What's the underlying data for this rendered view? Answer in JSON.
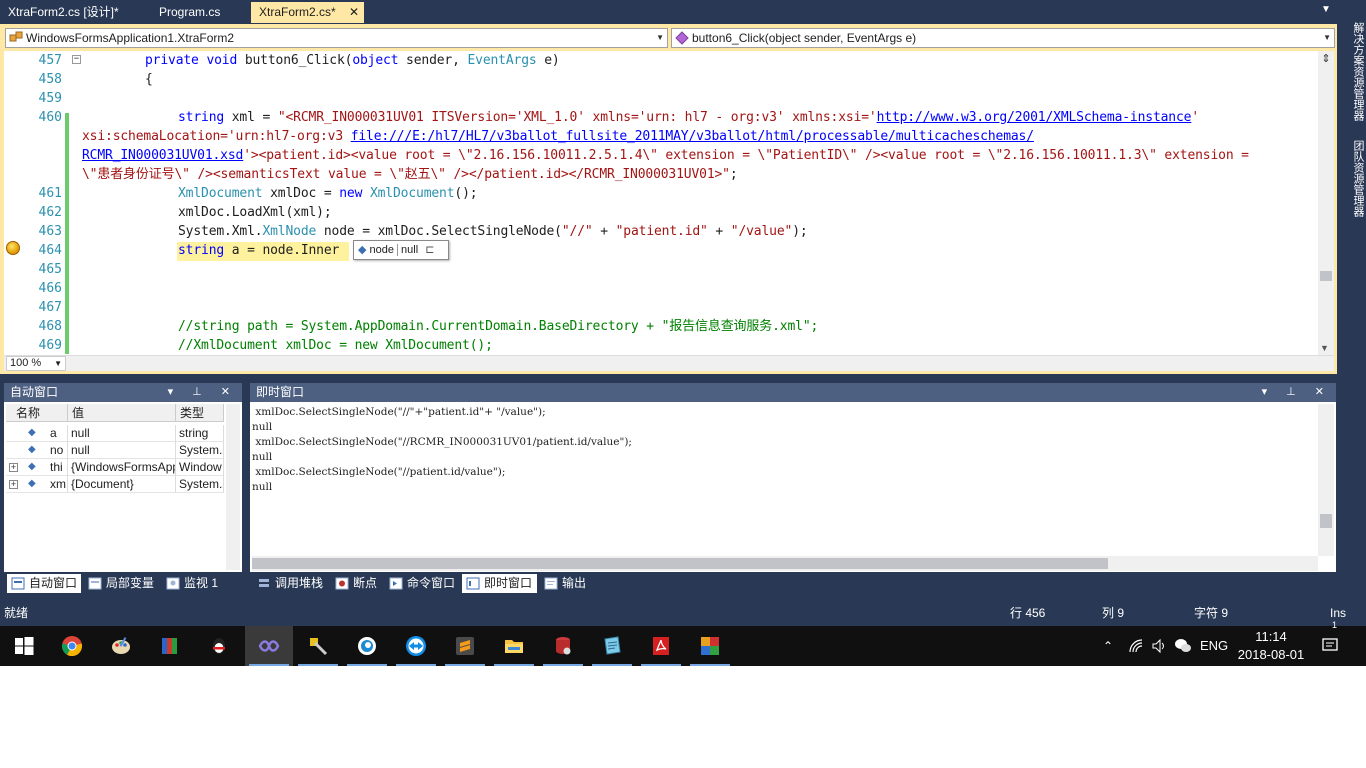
{
  "tabs": [
    {
      "label": "XtraForm2.cs [设计]*",
      "active": false
    },
    {
      "label": "Program.cs",
      "active": false
    },
    {
      "label": "XtraForm2.cs*",
      "active": true,
      "close": "✕"
    }
  ],
  "nav": {
    "class_combo": "WindowsFormsApplication1.XtraForm2",
    "member_combo": "button6_Click(object sender, EventArgs e)"
  },
  "code": {
    "lines": [
      {
        "num": "457"
      },
      {
        "num": "458"
      },
      {
        "num": "459"
      },
      {
        "num": "460"
      },
      {
        "num": ""
      },
      {
        "num": ""
      },
      {
        "num": ""
      },
      {
        "num": "461"
      },
      {
        "num": "462"
      },
      {
        "num": "463"
      },
      {
        "num": "464"
      },
      {
        "num": "465"
      },
      {
        "num": "466"
      },
      {
        "num": "467"
      },
      {
        "num": "468"
      },
      {
        "num": "469"
      }
    ],
    "t": {
      "l457a": "private",
      "l457b": "void",
      "l457c": " button6_Click(",
      "l457d": "object",
      "l457e": " sender, ",
      "l457f": "EventArgs",
      "l457g": " e)",
      "l458": "{",
      "l460a": "string",
      "l460b": " xml = ",
      "l460c": "\"<RCMR_IN000031UV01 ITSVersion='XML_1.0' xmlns='urn: hl7 - org:v3' xmlns:xsi='",
      "l460d": "http://www.w3.org/2001/XMLSchema-instance",
      "l460e": "'",
      "l460f": "xsi:schemaLocation='urn:hl7-org:v3 ",
      "l460g": "file:///E:/hl7/HL7/v3ballot_fullsite_2011MAY/v3ballot/html/processable/multicacheschemas/",
      "l460h": "RCMR_IN000031UV01.xsd",
      "l460i": "'><patient.id><value root = \\\"2.16.156.10011.2.5.1.4\\\" extension = \\\"PatientID\\\" /><value root = \\\"2.16.156.10011.1.3\\\" extension =",
      "l460j": "\\\"患者身份证号\\\" /><semanticsText value = \\\"赵五\\\" /></patient.id></RCMR_IN000031UV01>\"",
      "l460k": ";",
      "l461a": "XmlDocument",
      "l461b": " xmlDoc = ",
      "l461c": "new",
      "l461d": " ",
      "l461e": "XmlDocument",
      "l461f": "();",
      "l462": "xmlDoc.LoadXml(xml);",
      "l463a": "System.Xml.",
      "l463b": "XmlNode",
      "l463c": " node = xmlDoc.SelectSingleNode(",
      "l463d": "\"//\"",
      "l463e": " + ",
      "l463f": "\"patient.id\"",
      "l463g": " + ",
      "l463h": "\"/value\"",
      "l463i": ");",
      "l464a": "string",
      "l464b": " a = node.Inner",
      "l468a": "//string path = System.AppDomain.CurrentDomain.BaseDirectory + \"报告信息查询服务.xml\";",
      "l469a": "//XmlDocument xmlDoc = new XmlDocument();"
    }
  },
  "datatip": {
    "name": "node",
    "value": "null"
  },
  "zoom": "100 %",
  "autos": {
    "title": "自动窗口",
    "columns": [
      "名称",
      "值",
      "类型"
    ],
    "rows": [
      {
        "name": "a",
        "value": "null",
        "type": "string",
        "expandable": false
      },
      {
        "name": "no",
        "value": "null",
        "type": "System.X",
        "expandable": false
      },
      {
        "name": "thi",
        "value": "{WindowsFormsApp",
        "type": "Window",
        "expandable": true
      },
      {
        "name": "xm",
        "value": "{Document}",
        "type": "System.X",
        "expandable": true
      }
    ]
  },
  "immediate": {
    "title": "即时窗口",
    "lines": [
      " xmlDoc.SelectSingleNode(\"//\"+\"patient.id\"+ \"/value\");",
      "null",
      " xmlDoc.SelectSingleNode(\"//RCMR_IN000031UV01/patient.id/value\");",
      "null",
      " xmlDoc.SelectSingleNode(\"//patient.id/value\");",
      "null"
    ]
  },
  "bottom_tabs_left": [
    {
      "label": "自动窗口",
      "active": true
    },
    {
      "label": "局部变量",
      "active": false
    },
    {
      "label": "监视 1",
      "active": false
    }
  ],
  "bottom_tabs_right": [
    {
      "label": "调用堆栈",
      "active": false
    },
    {
      "label": "断点",
      "active": false
    },
    {
      "label": "命令窗口",
      "active": false
    },
    {
      "label": "即时窗口",
      "active": true
    },
    {
      "label": "输出",
      "active": false
    }
  ],
  "status": {
    "ready": "就绪",
    "line": "行 456",
    "col": "列 9",
    "char": "字符 9",
    "mode": "Ins"
  },
  "side_tabs": [
    "解决方案资源管理器",
    "团队资源管理器"
  ],
  "taskbar": {
    "apps": [
      "windows-start",
      "chrome",
      "paint",
      "archive",
      "qq",
      "visual-studio",
      "tool",
      "edge-browser",
      "teamviewer",
      "sublime",
      "file-explorer",
      "database",
      "notepad",
      "pdf-reader",
      "office"
    ],
    "lang": "ENG",
    "time": "11:14",
    "date": "2018-08-01",
    "notif_count": "1"
  },
  "colors": {
    "chrome": "#293955",
    "active_tab": "#ffe8a6",
    "keyword": "#0000ff",
    "type": "#2b91af",
    "string": "#a31515",
    "comment": "#008000"
  }
}
